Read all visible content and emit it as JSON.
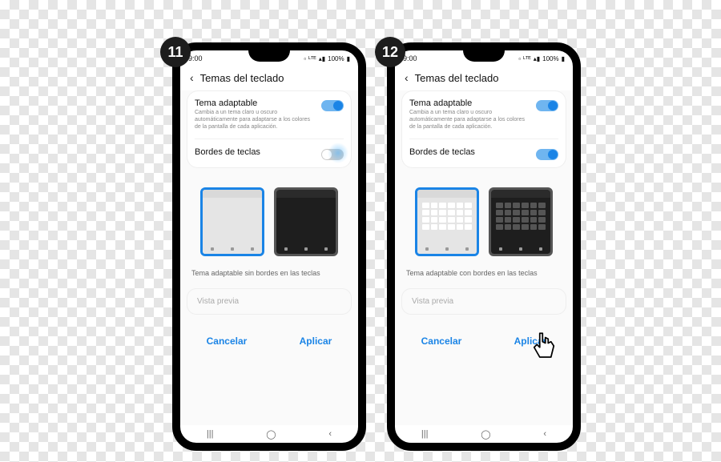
{
  "badges": {
    "b1": "11",
    "b2": "12"
  },
  "status": {
    "time": "9:00",
    "sig": "▫ₗₜₑ ᴸᵀᴱ ▴▮ 100%",
    "batt": "▮"
  },
  "header": {
    "title": "Temas del teclado",
    "back": "‹"
  },
  "toggle1": {
    "title": "Tema adaptable",
    "sub": "Cambia a un tema claro u oscuro automáticamente para adaptarse a los colores de la pantalla de cada aplicación."
  },
  "toggle2": {
    "title": "Bordes de teclas"
  },
  "desc": {
    "left": "Tema adaptable sin bordes en las teclas",
    "right": "Tema adaptable con bordes en las teclas"
  },
  "input": {
    "placeholder": "Vista previa"
  },
  "actions": {
    "cancel": "Cancelar",
    "apply": "Aplicar"
  },
  "nav": {
    "a": "|||",
    "b": "◯",
    "c": "‹"
  }
}
